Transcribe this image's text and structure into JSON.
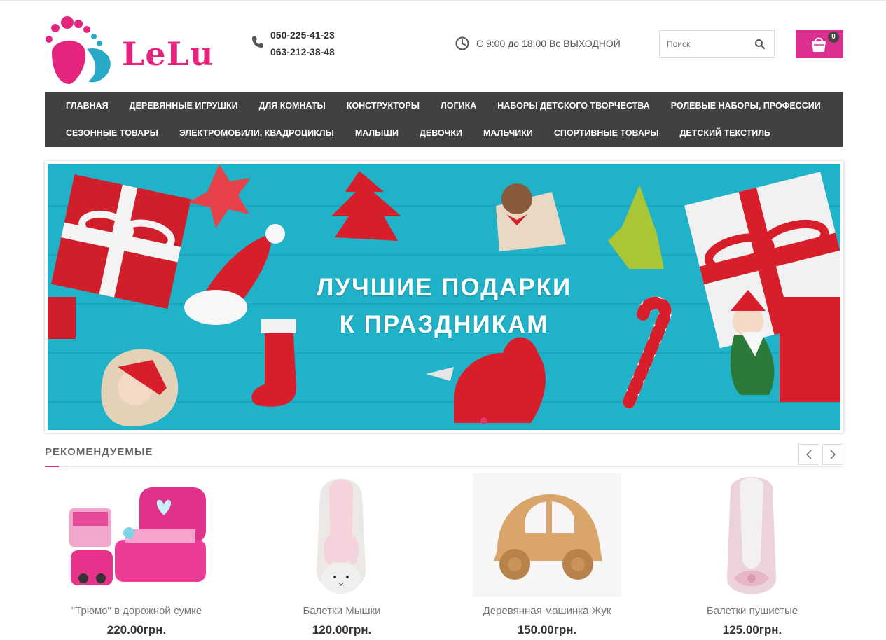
{
  "header": {
    "logo_text": "LeLu",
    "phones": [
      "050-225-41-23",
      "063-212-38-48"
    ],
    "hours": "С 9:00 до 18:00 Вс ВЫХОДНОЙ",
    "search_placeholder": "Поиск",
    "cart_count": "0"
  },
  "nav": {
    "row1": [
      "ГЛАВНАЯ",
      "ДЕРЕВЯННЫЕ ИГРУШКИ",
      "ДЛЯ КОМНАТЫ",
      "КОНСТРУКТОРЫ",
      "ЛОГИКА",
      "НАБОРЫ ДЕТСКОГО ТВОРЧЕСТВА",
      "РОЛЕВЫЕ НАБОРЫ, ПРОФЕССИИ"
    ],
    "row2": [
      "СЕЗОННЫЕ ТОВАРЫ",
      "ЭЛЕКТРОМОБИЛИ, КВАДРОЦИКЛЫ",
      "МАЛЫШИ",
      "ДЕВОЧКИ",
      "МАЛЬЧИКИ",
      "СПОРТИВНЫЕ ТОВАРЫ",
      "ДЕТСКИЙ ТЕКСТИЛЬ"
    ]
  },
  "banner": {
    "line1": "ЛУЧШИЕ ПОДАРКИ",
    "line2": "К ПРАЗДНИКАМ"
  },
  "recommended": {
    "title": "РЕКОМЕНДУЕМЫЕ",
    "products": [
      {
        "name": "\"Трюмо\" в дорожной сумке",
        "price": "220.00грн."
      },
      {
        "name": "Балетки Мышки",
        "price": "120.00грн."
      },
      {
        "name": "Деревянная машинка Жук",
        "price": "150.00грн."
      },
      {
        "name": "Балетки пушистые",
        "price": "125.00грн."
      }
    ]
  },
  "colors": {
    "brand_pink": "#dc2f8f",
    "logo_blue": "#29a9c8",
    "nav_bg": "#414141",
    "banner_bg": "#1fb2c9"
  }
}
